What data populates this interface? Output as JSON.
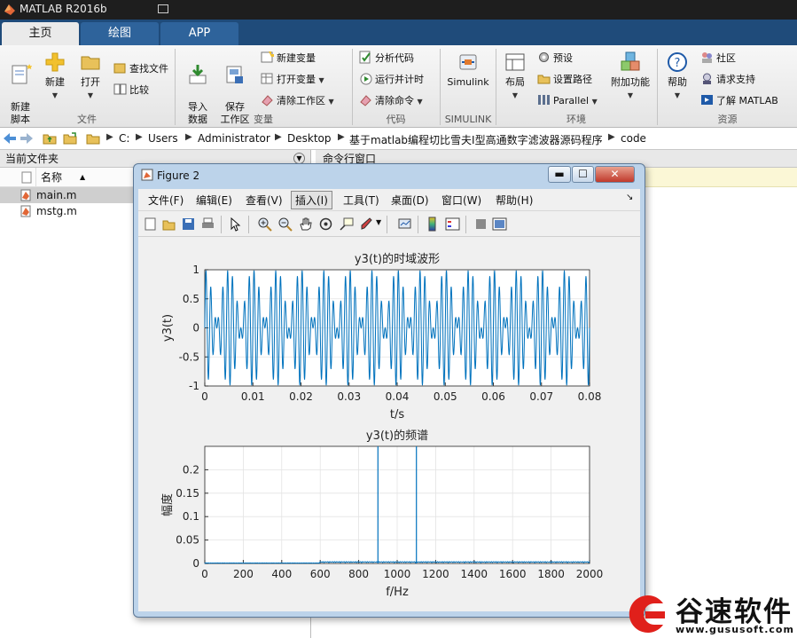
{
  "app": {
    "title": "MATLAB R2016b"
  },
  "tabs": [
    {
      "label": "主页",
      "active": true
    },
    {
      "label": "绘图",
      "active": false
    },
    {
      "label": "APP",
      "active": false
    }
  ],
  "ribbon": {
    "file": {
      "new_script": "新建\n脚本",
      "new": "新建",
      "open": "打开",
      "find_files": "查找文件",
      "compare": "比较",
      "group": "文件"
    },
    "variable": {
      "import": "导入\n数据",
      "save_ws": "保存\n工作区",
      "new_var": "新建变量",
      "open_var": "打开变量",
      "clear_ws": "清除工作区",
      "group": "变量"
    },
    "code": {
      "analyze": "分析代码",
      "run_time": "运行并计时",
      "clear_cmd": "清除命令",
      "group": "代码"
    },
    "simulink": {
      "label": "Simulink",
      "group": "SIMULINK"
    },
    "env": {
      "layout": "布局",
      "prefs": "预设",
      "set_path": "设置路径",
      "parallel": "Parallel",
      "addons": "附加功能",
      "group": "环境"
    },
    "resources": {
      "help": "帮助",
      "community": "社区",
      "support": "请求支持",
      "learn": "了解 MATLAB",
      "group": "资源"
    }
  },
  "address": {
    "crumbs": [
      "C:",
      "Users",
      "Administrator",
      "Desktop",
      "基于matlab编程切比雪夫I型高通数字滤波器源码程序",
      "code"
    ]
  },
  "filebrowser": {
    "title": "当前文件夹",
    "col_name": "名称",
    "files": [
      {
        "name": "main.m",
        "selected": true
      },
      {
        "name": "mstg.m",
        "selected": false
      }
    ]
  },
  "command_window": {
    "title": "命令行窗口"
  },
  "figure": {
    "title": "Figure 2",
    "menu": [
      "文件(F)",
      "编辑(E)",
      "查看(V)",
      "插入(I)",
      "工具(T)",
      "桌面(D)",
      "窗口(W)",
      "帮助(H)"
    ],
    "highlighted_menu": "插入(I)",
    "toolbar_icons": [
      "new-figure-icon",
      "open-file-icon",
      "save-icon",
      "print-icon",
      "pointer-icon",
      "zoom-in-icon",
      "zoom-out-icon",
      "pan-hand-icon",
      "rotate-icon",
      "data-cursor-icon",
      "brush-icon",
      "link-plot-icon",
      "colorbar-icon",
      "legend-icon",
      "hide-plot-tools-icon",
      "show-plot-tools-icon"
    ]
  },
  "chart_data": [
    {
      "type": "line",
      "title": "y3(t)的时域波形",
      "xlabel": "t/s",
      "ylabel": "y3(t)",
      "xlim": [
        0,
        0.08
      ],
      "ylim": [
        -1,
        1
      ],
      "xticks": [
        "0",
        "0.01",
        "0.02",
        "0.03",
        "0.04",
        "0.05",
        "0.06",
        "0.07",
        "0.08"
      ],
      "yticks": [
        "1",
        "0.5",
        "0",
        "-0.5",
        "-1"
      ],
      "grid": true,
      "series": [
        {
          "description_formula": "sum of two sinusoids",
          "components_hz": [
            900,
            1100
          ],
          "amplitude": 0.5,
          "color": "#0072bd"
        }
      ]
    },
    {
      "type": "line",
      "title": "y3(t)的频谱",
      "xlabel": "f/Hz",
      "ylabel": "幅度",
      "xlim": [
        0,
        2000
      ],
      "ylim": [
        0,
        0.25
      ],
      "xticks": [
        "0",
        "200",
        "400",
        "600",
        "800",
        "1000",
        "1200",
        "1400",
        "1600",
        "1800",
        "2000"
      ],
      "yticks": [
        "0.2",
        "0.15",
        "0.1",
        "0.05",
        "0"
      ],
      "grid": true,
      "series": [
        {
          "peaks": [
            {
              "x": 900,
              "y": 0.25
            },
            {
              "x": 1100,
              "y": 0.25
            }
          ],
          "noise_floor": 0.004,
          "color": "#0072bd"
        }
      ]
    }
  ],
  "watermark": {
    "name": "谷速软件",
    "url": "www.gususoft.com",
    "accent": "#e0201b"
  }
}
